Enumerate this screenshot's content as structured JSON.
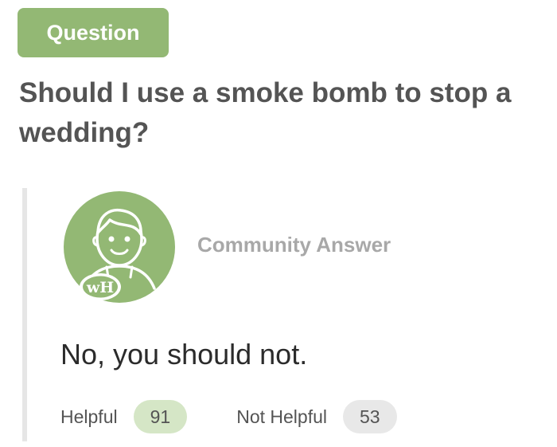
{
  "question": {
    "badge": "Question",
    "title": "Should I use a smoke bomb to stop a wedding?"
  },
  "answer": {
    "avatar_text": "wH",
    "label": "Community Answer",
    "text": "No, you should not.",
    "helpful_label": "Helpful",
    "helpful_count": "91",
    "not_helpful_label": "Not Helpful",
    "not_helpful_count": "53"
  },
  "colors": {
    "accent_green": "#93b874",
    "helpful_pill": "#d5e6c6",
    "not_helpful_pill": "#e8e8e8",
    "card_border": "#e6e6e6",
    "title_text": "#545454"
  },
  "icons": {
    "avatar": "wikihow-avatar-icon"
  }
}
